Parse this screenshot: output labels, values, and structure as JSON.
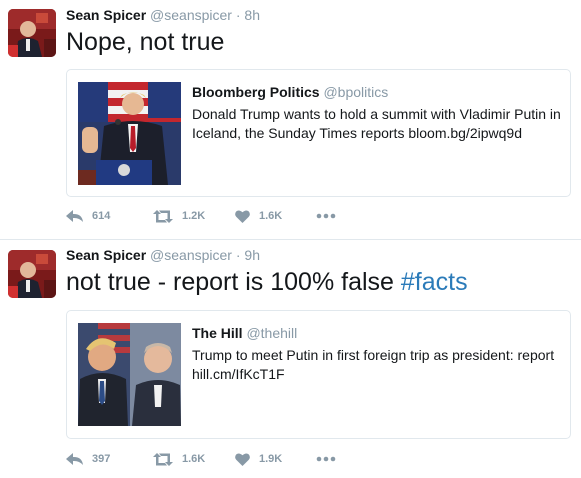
{
  "tweets": [
    {
      "author_name": "Sean Spicer",
      "author_handle": "@seanspicer",
      "separator": "·",
      "time": "8h",
      "text": "Nope, not true",
      "hashtag": "",
      "card": {
        "source_name": "Bloomberg Politics",
        "source_handle": "@bpolitics",
        "text": "Donald Trump wants to hold a summit with Vladimir Putin in Iceland, the Sunday Times reports",
        "link": "bloom.bg/2ipwq9d"
      },
      "actions": {
        "replies": "614",
        "retweets": "1.2K",
        "likes": "1.6K"
      }
    },
    {
      "author_name": "Sean Spicer",
      "author_handle": "@seanspicer",
      "separator": "·",
      "time": "9h",
      "text": "not true - report is 100% false ",
      "hashtag": "#facts",
      "card": {
        "source_name": "The Hill",
        "source_handle": "@thehill",
        "text": "Trump to meet Putin in first foreign trip as president: report",
        "link": "hill.cm/IfKcT1F"
      },
      "actions": {
        "replies": "397",
        "retweets": "1.6K",
        "likes": "1.9K"
      }
    }
  ],
  "icons": [
    "reply-icon",
    "retweet-icon",
    "heart-icon",
    "more-icon"
  ],
  "colors": {
    "link": "#2b7bb9",
    "muted": "#8899a6",
    "border": "#e1e8ed"
  }
}
